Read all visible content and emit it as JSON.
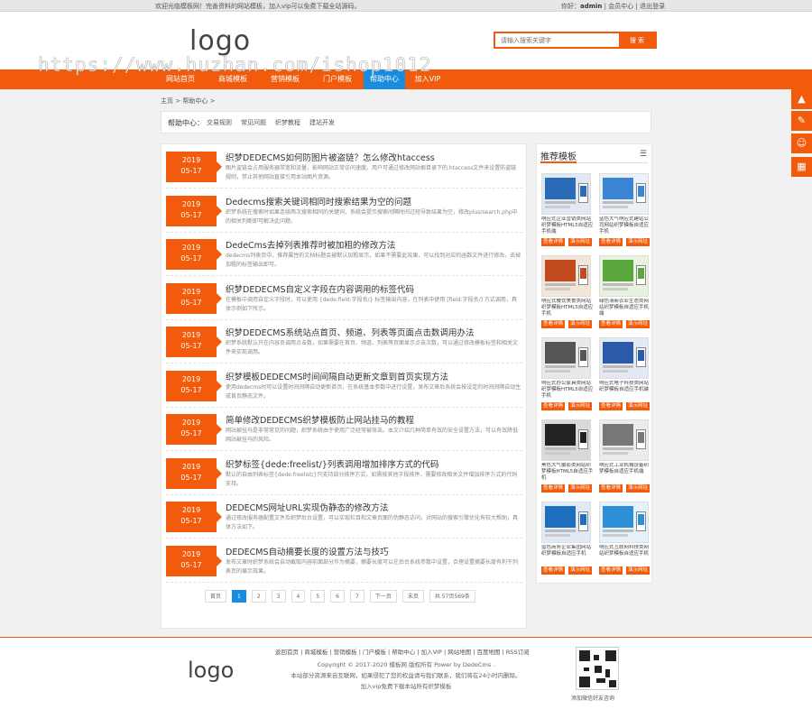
{
  "topbar": {
    "welcome": "欢迎光临模板网！完善资料的网站模板，加入vip可以免费下载全站源码。",
    "greeting": "你好：",
    "username": "admin",
    "member_center": "会员中心",
    "logout": "退出登录",
    "sep": "|"
  },
  "header": {
    "logo": "logo",
    "search_placeholder": "请输入搜索关键字",
    "search_button": "搜 索",
    "watermark": "https://www.huzhan.com/ishop1012"
  },
  "nav": {
    "items": [
      "网站首页",
      "商城模板",
      "营销模板",
      "门户模板",
      "帮助中心",
      "加入VIP"
    ],
    "active_index": 4
  },
  "breadcrumb": "主页 > 帮助中心 >",
  "help": {
    "title": "帮助中心：",
    "links": [
      "交易规则",
      "常见问题",
      "织梦教程",
      "建站开发"
    ]
  },
  "articles": [
    {
      "year": "2019",
      "md": "05-17",
      "title": "织梦DEDECMS如何防图片被盗链？怎么修改htaccess",
      "desc": "图片盗链会占用服务器带宽和流量，影响网站正常访问速度。用户可通过修改网站根目录下的.htaccess文件来设置防盗链规则，禁止其他网站直接引用本站图片资源。"
    },
    {
      "year": "2019",
      "md": "05-17",
      "title": "Dedecms搜索关键词相同时搜索结果为空的问题",
      "desc": "织梦系统在搜索时如果连续两次搜索相同的关键词，系统会提示搜索间隔时间过短导致结果为空，修改plus/search.php中的相关判断即可解决此问题。"
    },
    {
      "year": "2019",
      "md": "05-17",
      "title": "DedeCms去掉列表推荐时被加粗的修改方法",
      "desc": "dedecms列表页中，推荐属性的文档标题会被默认加粗显示，如果不需要此效果，可以找到对应的函数文件进行修改，去掉加粗的标签输出即可。"
    },
    {
      "year": "2019",
      "md": "05-17",
      "title": "织梦DEDECMS自定义字段在内容调用的标签代码",
      "desc": "在模板中调用自定义字段时，可以使用 {dede:field.字段名/} 标签输出内容，在列表中使用 [field:字段名/] 方式调用，具体示例如下所示。"
    },
    {
      "year": "2019",
      "md": "05-17",
      "title": "织梦DEDECMS系统站点首页、频道、列表等页面点击数调用办法",
      "desc": "织梦系统默认只在内容页调用点击数，如果需要在首页、频道、列表等页面显示点击次数，可以通过修改模板标签和相关文件来实现调用。"
    },
    {
      "year": "2019",
      "md": "05-17",
      "title": "织梦模板DEDECMS时间间隔自动更新文章到首页实现方法",
      "desc": "使用dedecms时可以设置时间间隔自动更新首页，在系统基本参数中进行设置，发布文章后系统会按设定的时间间隔自动生成首页静态文件。"
    },
    {
      "year": "2019",
      "md": "05-17",
      "title": "简单修改DEDECMS织梦模板防止网站挂马的教程",
      "desc": "网站被挂马是非常常见的问题，织梦系统由于使用广泛经常被攻击。本文介绍几种简单有效的安全设置方法，可以有效降低网站被挂马的风险。"
    },
    {
      "year": "2019",
      "md": "05-17",
      "title": "织梦标签{dede:freelist/}列表调用增加排序方式的代码",
      "desc": "默认的自由列表标签{dede:freelist/}只支持部分排序方式，如需按其他字段排序，需要修改相关文件增加排序方式的代码支持。"
    },
    {
      "year": "2019",
      "md": "05-17",
      "title": "DEDECMS网址URL实现伪静态的修改方法",
      "desc": "通过修改服务器配置文件及织梦后台设置，可以实现栏目和文章页面的伪静态访问，对网站的搜索引擎优化有较大帮助，具体方法如下。"
    },
    {
      "year": "2019",
      "md": "05-17",
      "title": "DEDECMS自动摘要长度的设置方法与技巧",
      "desc": "发布文章时织梦系统会自动截取内容前面部分作为摘要，摘要长度可以在后台系统参数中设置，合理设置摘要长度有利于列表页的展示效果。"
    }
  ],
  "pagination": {
    "first": "首页",
    "pages": [
      "1",
      "2",
      "3",
      "4",
      "5",
      "6",
      "7"
    ],
    "current": "1",
    "next": "下一页",
    "last": "末页",
    "total": "共 57页569条"
  },
  "sidebar": {
    "title": "推荐模板",
    "detail_label": "查看详情",
    "demo_label": "演示网址",
    "items": [
      {
        "name": "响应式企业营销类网站织梦模板HTML5自适应手机端"
      },
      {
        "name": "蓝色大气响应式建站公司网站织梦模板自适应手机"
      },
      {
        "name": "响应式餐饮美食类网站织梦模板HTML5自适应手机"
      },
      {
        "name": "绿色清新农业生态类网站织梦模板自适应手机端"
      },
      {
        "name": "响应式办公家具类网站织梦模板HTML5自适应手机"
      },
      {
        "name": "响应式电子科技类网站织梦模板自适应手机端"
      },
      {
        "name": "黑色大气摄影类网站织梦模板HTML5自适应手机"
      },
      {
        "name": "响应式工业机械设备织梦模板自适应手机端"
      },
      {
        "name": "蓝色商务企业集团网站织梦模板自适应手机"
      },
      {
        "name": "响应式互联网科技类网站织梦模板自适应手机"
      }
    ]
  },
  "float_icons": [
    "top-icon",
    "edit-icon",
    "qq-icon",
    "qrcode-icon"
  ],
  "footer": {
    "links": "返回首页 | 商城模板 | 营销模板 | 门户模板 | 帮助中心 | 加入VIP | 网站地图 | 百度地图 | RSS订阅",
    "copyright": "Copyright © 2017-2020 模板网 版权所有 Power by DedeCms .",
    "notice": "本站部分资源来自互联网，如果侵犯了您的权益请与我们联系，我们将在24小时内删除。",
    "vip": "加入vip免费下载本站所有织梦模板",
    "logo": "logo",
    "qr_text": "添加微信好友咨询"
  },
  "colors": {
    "accent": "#f25a0c",
    "active": "#1a8ce0"
  }
}
